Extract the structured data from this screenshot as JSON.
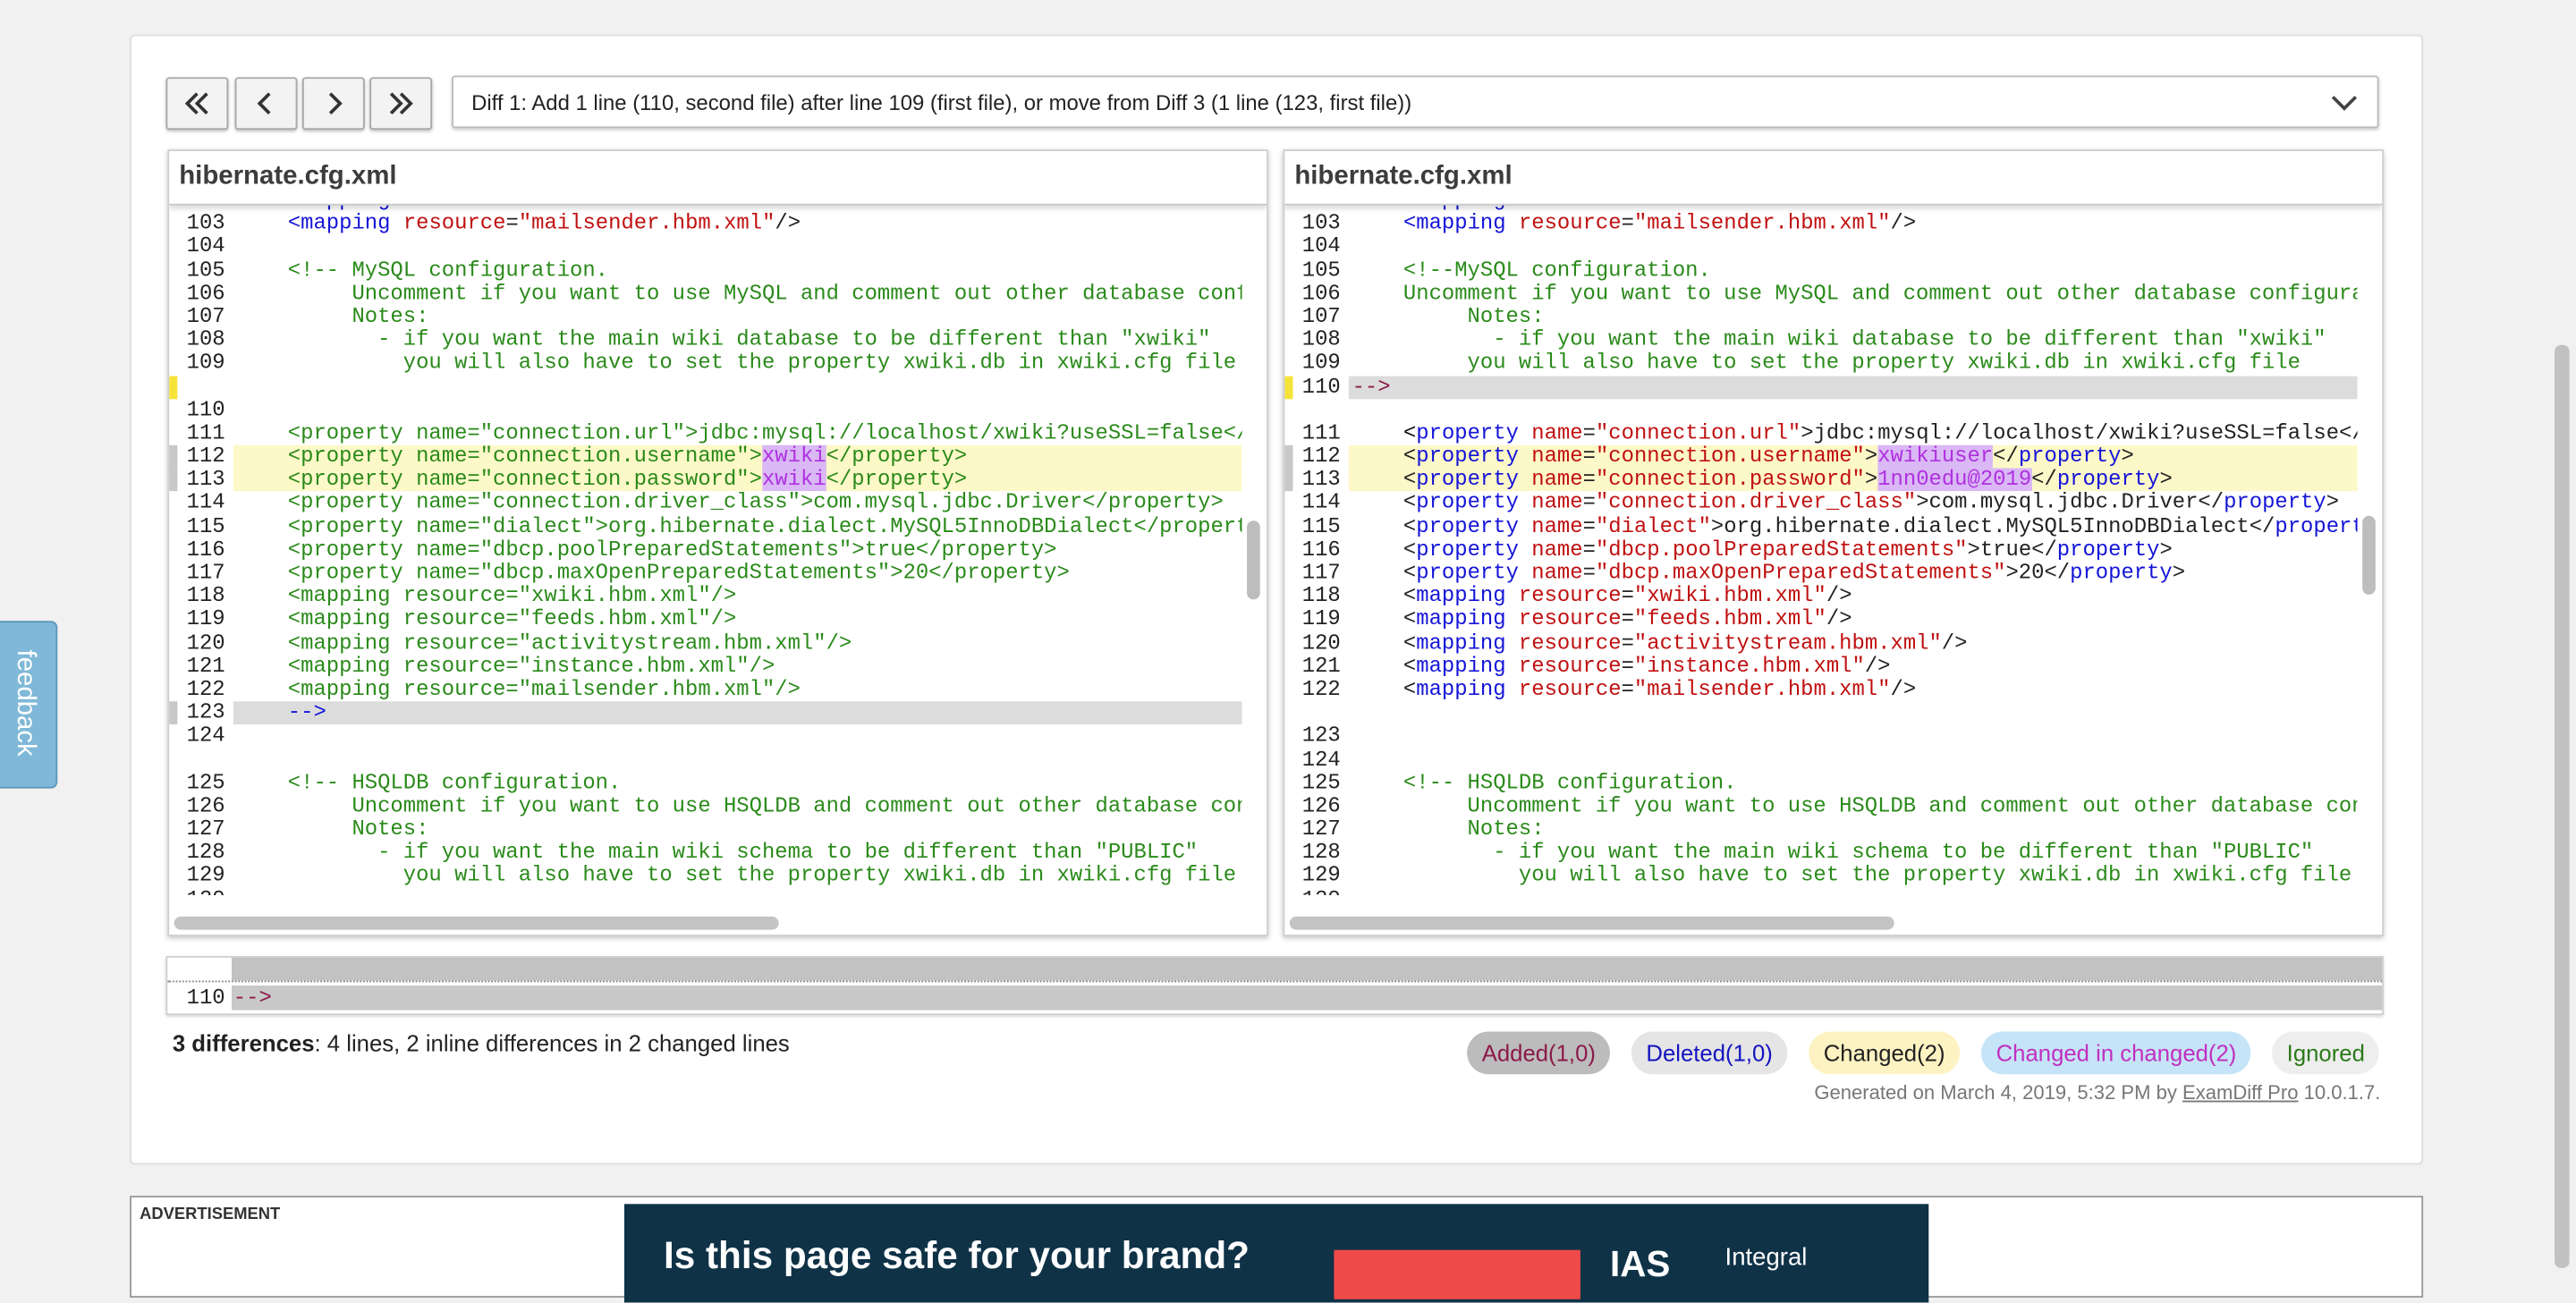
{
  "nav": {
    "first": "first-diff",
    "prev": "previous-diff",
    "next": "next-diff",
    "last": "last-diff"
  },
  "diff_select": {
    "value": "Diff 1: Add 1 line (110, second file) after line 109 (first file), or move from Diff 3 (1 line (123, first file))"
  },
  "left_pane": {
    "title": "hibernate.cfg.xml"
  },
  "right_pane": {
    "title": "hibernate.cfg.xml"
  },
  "strip": {
    "line_no": "110",
    "text": "-->"
  },
  "summary": {
    "bold": "3 differences",
    "rest": ": 4 lines, 2 inline differences in 2 changed lines"
  },
  "legend": {
    "added": "Added(1,0)",
    "deleted": "Deleted(1,0)",
    "changed": "Changed(2)",
    "changed_in_changed": "Changed in changed(2)",
    "ignored": "Ignored"
  },
  "generated": {
    "prefix": "Generated on March 4, 2019, 5:32 PM by ",
    "tool": "ExamDiff Pro",
    "version": " 10.0.1.7."
  },
  "feedback": "feedback",
  "ad": {
    "label": "ADVERTISEMENT",
    "headline": "Is this page safe for your brand?",
    "logo": "IAS",
    "logo_sub": "Integral"
  },
  "colors": {
    "added_bg": "#bcbcbc",
    "deleted_bg": "#e5e5e5",
    "changed_bg": "#fdf3c2",
    "changed_in_changed_bg": "#c6e4f7",
    "ignored_bg": "#eeeeee",
    "changed_line": "#fdf8c8",
    "inline_change": "#d9b8f5"
  }
}
